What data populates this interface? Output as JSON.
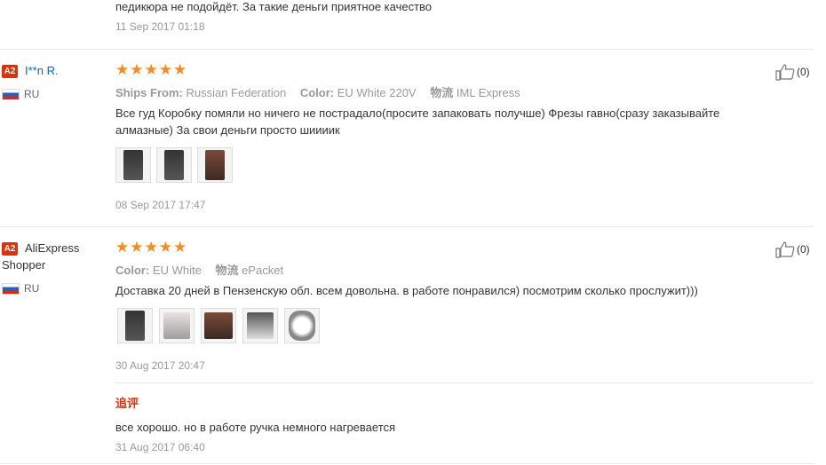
{
  "top": {
    "text": "педикюра не подойдёт. За такие деньги приятное качество",
    "date": "11 Sep 2017 01:18"
  },
  "reviews": [
    {
      "level": "A2",
      "name": "I**n R.",
      "country": "RU",
      "stars": "★★★★★",
      "ships_from_label": "Ships From:",
      "ships_from": "Russian Federation",
      "color_label": "Color:",
      "color": "EU White 220V",
      "logistics_label": "物流",
      "logistics": "IML Express",
      "text": "Все гуд Коробку помяли но ничего не пострадало(просите запаковать получше) Фрезы гавно(сразу заказывайте алмазные) За свои деньги просто шиииик",
      "date": "08 Sep 2017 17:47",
      "helpful": "(0)"
    },
    {
      "level": "A2",
      "name_line1": "AliExpress",
      "name_line2": "Shopper",
      "country": "RU",
      "stars": "★★★★★",
      "color_label": "Color:",
      "color": "EU White",
      "logistics_label": "物流",
      "logistics": "ePacket",
      "text": "Доставка 20 дней в Пензенскую обл. всем довольна. в работе понравился) посмотрим сколько прослужит)))",
      "date": "30 Aug 2017 20:47",
      "helpful": "(0)",
      "followup_title": "追评",
      "followup_text": "все хорошо. но в работе ручка немного нагревается",
      "followup_date": "31 Aug 2017 06:40"
    }
  ],
  "colors": {
    "star": "#f88b1c",
    "badge": "#e62e04",
    "link": "#0066cc"
  },
  "icons": [
    "thumbs-up-icon",
    "russia-flag-icon",
    "review-photo"
  ]
}
